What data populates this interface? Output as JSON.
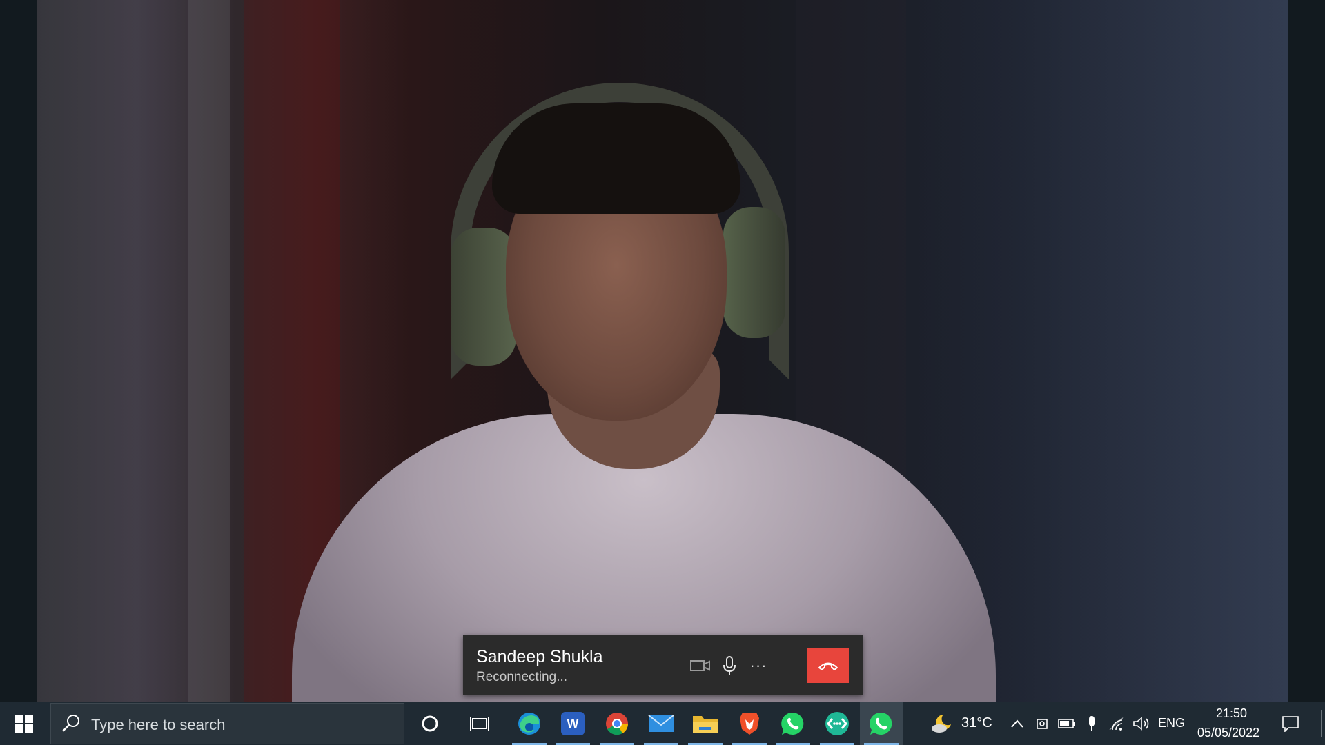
{
  "call": {
    "caller_name": "Sandeep Shukla",
    "status": "Reconnecting...",
    "controls": {
      "video_icon": "video-camera-icon",
      "mic_icon": "microphone-icon",
      "more_label": "···",
      "end_icon": "hang-up-icon"
    },
    "colors": {
      "bar": "#2b2b2b",
      "end_call": "#e8453c"
    }
  },
  "taskbar": {
    "start_icon": "windows-logo-icon",
    "search": {
      "placeholder": "Type here to search"
    },
    "apps": [
      {
        "name": "Cortana",
        "icon": "cortana-circle-icon"
      },
      {
        "name": "Task View",
        "icon": "task-view-icon"
      },
      {
        "name": "Microsoft Edge",
        "icon": "edge-icon",
        "running": true
      },
      {
        "name": "Microsoft Word",
        "icon": "word-icon",
        "letter": "W",
        "running": true
      },
      {
        "name": "Google Chrome",
        "icon": "chrome-icon",
        "running": true
      },
      {
        "name": "Mail",
        "icon": "mail-icon",
        "running": true
      },
      {
        "name": "File Explorer",
        "icon": "folder-icon",
        "running": true
      },
      {
        "name": "Brave",
        "icon": "brave-icon",
        "running": true
      },
      {
        "name": "WhatsApp",
        "icon": "whatsapp-icon",
        "running": true
      },
      {
        "name": "Remote Desktop",
        "icon": "remote-icon",
        "running": true
      },
      {
        "name": "WhatsApp Call",
        "icon": "whatsapp-icon",
        "running": true,
        "active": true
      }
    ],
    "tray": {
      "weather_icon": "moon-cloud-icon",
      "temperature": "31°C",
      "language": "ENG",
      "time": "21:50",
      "date": "05/05/2022"
    }
  }
}
